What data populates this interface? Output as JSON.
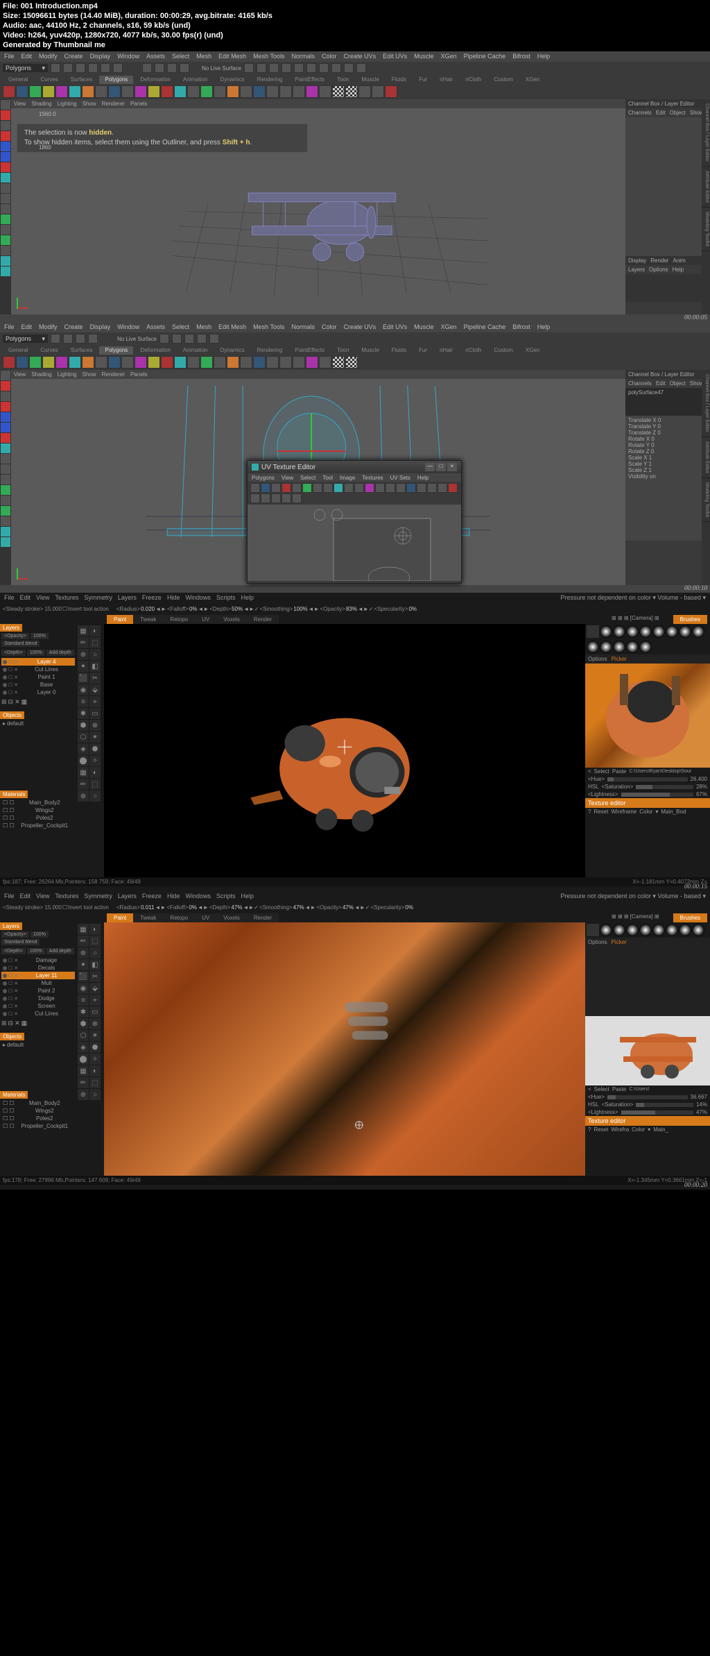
{
  "header": {
    "file_label": "File:",
    "file": "001 Introduction.mp4",
    "size_label": "Size:",
    "size": "15096611 bytes (14.40 MiB), duration: 00:00:29, avg.bitrate: 4165 kb/s",
    "audio_label": "Audio:",
    "audio": "aac, 44100 Hz, 2 channels, s16, 59 kb/s (und)",
    "video_label": "Video:",
    "video": "h264, yuv420p, 1280x720, 4077 kb/s, 30.00 fps(r) (und)",
    "gen": "Generated by Thumbnail me"
  },
  "maya": {
    "menus": [
      "File",
      "Edit",
      "Modify",
      "Create",
      "Display",
      "Window",
      "Assets",
      "Select",
      "Mesh",
      "Edit Mesh",
      "Mesh Tools",
      "Normals",
      "Color",
      "Create UVs",
      "Edit UVs",
      "Muscle",
      "XGen",
      "Pipeline Cache",
      "Bifrost",
      "Help"
    ],
    "mode": "Polygons",
    "no_live": "No Live Surface",
    "shelves": [
      "General",
      "Curves",
      "Surfaces",
      "Polygons",
      "Deformation",
      "Animation",
      "Dynamics",
      "Rendering",
      "PaintEffects",
      "Toon",
      "Muscle",
      "Fluids",
      "Fur",
      "nHair",
      "nCloth",
      "Custom",
      "XGen"
    ],
    "vp_menu": [
      "View",
      "Shading",
      "Lighting",
      "Show",
      "Renderer",
      "Panels"
    ],
    "chan_title": "Channel Box / Layer Editor",
    "chan_tabs": [
      "Channels",
      "Edit",
      "Object",
      "Show"
    ],
    "chan_btns": [
      "Display",
      "Render",
      "Anim"
    ],
    "layer_tabs": [
      "Layers",
      "Options",
      "Help"
    ],
    "side_tabs": [
      "Channel Box / Layer Editor",
      "Attribute Editor",
      "Modeling Toolkit"
    ],
    "hint1a": "The selection is now ",
    "hint1b": "hidden",
    "hint1c": ".",
    "hint2a": "To show hidden items, select them using the Outliner, and press ",
    "hint2b": "Shift + h",
    "hint2c": ".",
    "readout": "1560                    0",
    "readout2": "1860",
    "obj_name": "polySurface47",
    "attrs": [
      "Translate X 0",
      "Translate Y 0",
      "Translate Z 0",
      "Rotate X 0",
      "Rotate Y 0",
      "Rotate Z 0",
      "Scale X 1",
      "Scale Y 1",
      "Scale Z 1",
      "Visibility on"
    ],
    "ts1": "00:00:05",
    "ts2": "00:00:10",
    "uv_title": "UV Texture Editor",
    "uv_menus": [
      "Polygons",
      "View",
      "Select",
      "Tool",
      "Image",
      "Textures",
      "UV Sets",
      "Help"
    ]
  },
  "coat": {
    "menus": [
      "File",
      "Edit",
      "View",
      "Textures",
      "Symmetry",
      "Layers",
      "Freeze",
      "Hide",
      "Windows",
      "Scripts",
      "Help"
    ],
    "rinfo": "Pressure not dependent on color  ▾  Volume - based  ▾",
    "steady": "<Steady stroke> 15.000",
    "invert": "Invert tool action",
    "radius_l": "<Radius>",
    "r1": "0.020",
    "r2": "0.011",
    "falloff_l": "<Falloff>",
    "f": "0%",
    "depth_l": "<Depth>",
    "d1": "50%",
    "d2": "47%",
    "smooth_l": "<Smoothing>",
    "s1": "100%",
    "s2": "47%",
    "opac_l": "<Opacity>",
    "o1": "83%",
    "o2": "47%",
    "spec_l": "<Specularity>",
    "sp": "0%",
    "modes": [
      "Paint",
      "Tweak",
      "Retopo",
      "UV",
      "Voxels",
      "Render"
    ],
    "cam_l": "[Camera]",
    "layers_t": "Layers",
    "opacity_l": "<Opacity>",
    "depth2_l": "<Depth>",
    "pct": "100%",
    "blend": "Standard blend",
    "add_depth": "Add depth",
    "layers1": [
      "Layer 4",
      "Cut Lines",
      "Paint 1",
      "Base",
      "Layer 0"
    ],
    "layers2": [
      "Damage",
      "Decals",
      "Layer 11",
      "Mult",
      "Paint 2",
      "Dodge",
      "Screen",
      "Cut Lines"
    ],
    "objects_t": "Objects",
    "obj": "default",
    "materials_t": "Materials",
    "mats": [
      "Main_Body2",
      "Wings2",
      "Poles2",
      "Propeller_Cockpit1"
    ],
    "brushes_t": "Brushes",
    "options_t": "Options",
    "picker_t": "Picker",
    "sel_l": "Select",
    "paste_l": "Paste",
    "path1": "C:\\Users\\Ryan\\Desktop\\Sour",
    "path2": "C:\\Users\\",
    "hsl": "HSL",
    "hue_l": "<Hue>",
    "sat_l": "<Saturation>",
    "light_l": "<Lightness>",
    "hue1": "26.400",
    "sat1": "28%",
    "light1": "67%",
    "hue2": "36.667",
    "sat2": "14%",
    "light2": "47%",
    "tex_t": "Texture editor",
    "tex_btns": [
      "?",
      "Reset",
      "Wireframe",
      "Color",
      "▾",
      "Main_Bod"
    ],
    "tex_btns2": [
      "?",
      "Reset",
      "Wirefra",
      "Color",
      "▾",
      "Main_"
    ],
    "status1": "fps:187;   Free: 26264 Mb,Pointers: 158 759; Face: 49/49",
    "coords1": "X=-1.181mm Y=0.4072mm Z=",
    "status2": "fps:178;   Free: 27996 Mb,Pointers: 147 609; Face: 49/49",
    "coords2": "X=-1.345mm Y=0.3661mm Z=-1",
    "ts3": "00:00:15",
    "ts4": "00:00:20"
  }
}
